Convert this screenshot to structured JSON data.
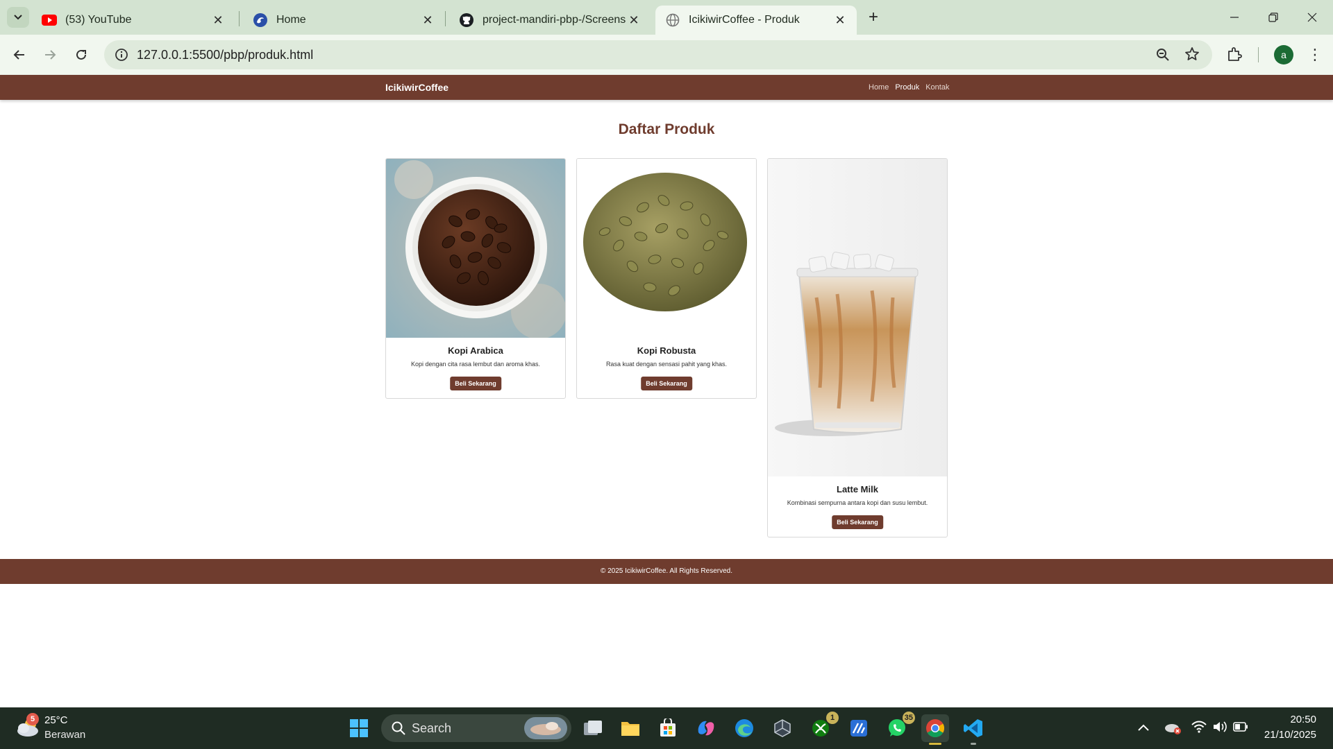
{
  "browser": {
    "tabs": [
      {
        "label": "(53) YouTube",
        "icon": "youtube-icon"
      },
      {
        "label": "Home",
        "icon": "app-logo-icon"
      },
      {
        "label": "project-mandiri-pbp-/Screensh",
        "icon": "github-icon"
      },
      {
        "label": "IcikiwirCoffee - Produk",
        "icon": "globe-icon"
      }
    ],
    "url": "127.0.0.1:5500/pbp/produk.html",
    "profile_initial": "a"
  },
  "site": {
    "brand": "IcikiwirCoffee",
    "nav": [
      "Home",
      "Produk",
      "Kontak"
    ],
    "title": "Daftar Produk",
    "products": [
      {
        "name": "Kopi Arabica",
        "desc": "Kopi dengan cita rasa lembut dan aroma khas.",
        "button": "Beli Sekarang",
        "image": "roasted-coffee-beans-in-bowl"
      },
      {
        "name": "Kopi Robusta",
        "desc": "Rasa kuat dengan sensasi pahit yang khas.",
        "button": "Beli Sekarang",
        "image": "green-coffee-beans-pile"
      },
      {
        "name": "Latte Milk",
        "desc": "Kombinasi sempurna antara kopi dan susu lembut.",
        "button": "Beli Sekarang",
        "image": "iced-latte-cup"
      }
    ],
    "footer": "© 2025 IcikiwirCoffee. All Rights Reserved.",
    "colors": {
      "brand": "#6f3c2e"
    }
  },
  "taskbar": {
    "weather": {
      "temp": "25°C",
      "condition": "Berawan",
      "badge": "5"
    },
    "search_label": "Search",
    "badges": {
      "xbox": "1",
      "whatsapp": "35"
    },
    "clock": {
      "time": "20:50",
      "date": "21/10/2025"
    }
  }
}
